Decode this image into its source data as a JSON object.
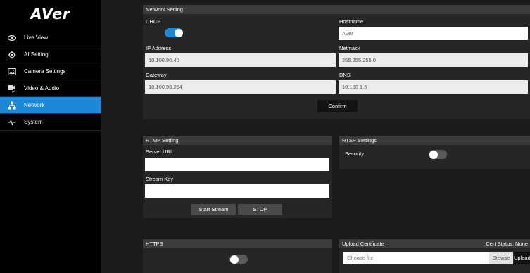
{
  "brand": {
    "logo": "AVer"
  },
  "sidebar": {
    "items": [
      {
        "label": "Live View",
        "icon": "eye-icon"
      },
      {
        "label": "AI Setting",
        "icon": "ai-icon"
      },
      {
        "label": "Camera Settings",
        "icon": "image-icon"
      },
      {
        "label": "Video & Audio",
        "icon": "video-audio-icon"
      },
      {
        "label": "Network",
        "icon": "network-icon",
        "active": true
      },
      {
        "label": "System",
        "icon": "pulse-icon"
      }
    ]
  },
  "network": {
    "title": "Network Setting",
    "dhcp_label": "DHCP",
    "dhcp_on": true,
    "hostname_label": "Hostname",
    "hostname_value": "AVer",
    "ip_label": "IP Address",
    "ip_value": "10.100.90.40",
    "netmask_label": "Netmask",
    "netmask_value": "255.255.255.0",
    "gateway_label": "Gateway",
    "gateway_value": "10.100.90.254",
    "dns_label": "DNS",
    "dns_value": "10.100.1.6",
    "confirm_label": "Confirm"
  },
  "rtmp": {
    "title": "RTMP Setting",
    "server_url_label": "Server URL",
    "server_url_value": "",
    "stream_key_label": "Stream Key",
    "stream_key_value": "",
    "start_label": "Start Stream",
    "stop_label": "STOP"
  },
  "rtsp": {
    "title": "RTSP Settings",
    "security_label": "Security",
    "security_on": false
  },
  "https": {
    "title": "HTTPS",
    "enabled": false
  },
  "certificate": {
    "title": "Upload Certificate",
    "status_label": "Cert Status: None",
    "file_placeholder": "Choose file",
    "browse_label": "Browse",
    "upload_label": "Upload"
  },
  "colors": {
    "accent": "#1e88d8",
    "panel": "#262626",
    "header": "#3b3b3b"
  }
}
